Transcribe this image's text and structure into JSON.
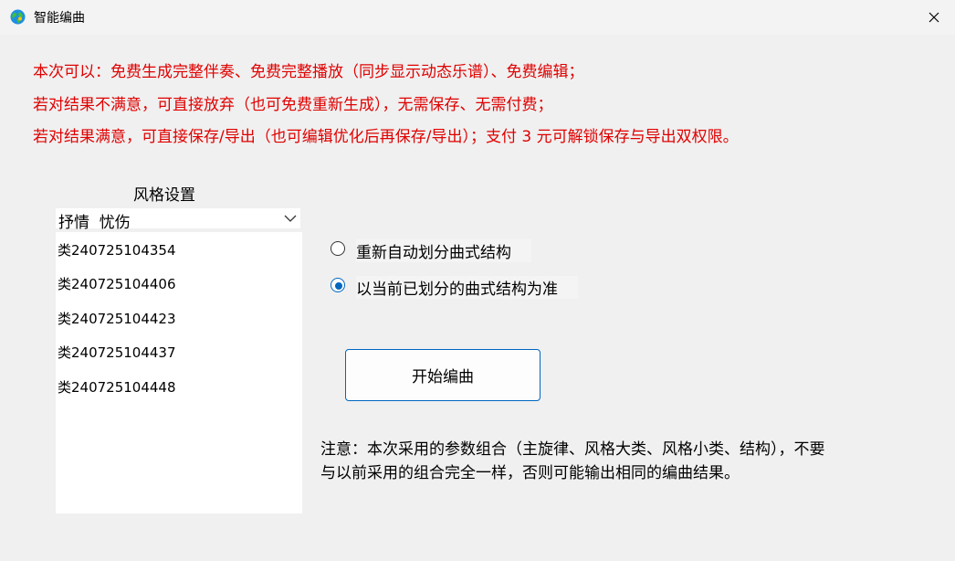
{
  "window": {
    "title": "智能编曲",
    "icon": "app-globe-icon",
    "close_icon": "close-icon"
  },
  "notices": [
    "本次可以：免费生成完整伴奏、免费完整播放（同步显示动态乐谱）、免费编辑；",
    "若对结果不满意，可直接放弃（也可免费重新生成），无需保存、无需付费；",
    "若对结果满意，可直接保存/导出（也可编辑优化后再保存/导出）；支付 3 元可解锁保存与导出双权限。"
  ],
  "style_settings": {
    "label": "风格设置",
    "selected": "抒情  忧伤",
    "items": [
      "类240725104354",
      "类240725104406",
      "类240725104423",
      "类240725104437",
      "类240725104448"
    ]
  },
  "options": {
    "radio1": {
      "label": "重新自动划分曲式结构",
      "checked": false
    },
    "radio2": {
      "label": "以当前已划分的曲式结构为准",
      "checked": true
    }
  },
  "start_button": "开始编曲",
  "note_lines": [
    "注意：本次采用的参数组合（主旋律、风格大类、风格小类、结构），不要",
    "与以前采用的组合完全一样，否则可能输出相同的编曲结果。"
  ],
  "colors": {
    "notice_red": "#e00000",
    "accent_blue": "#0067c0",
    "window_bg": "#f0f0f0"
  }
}
